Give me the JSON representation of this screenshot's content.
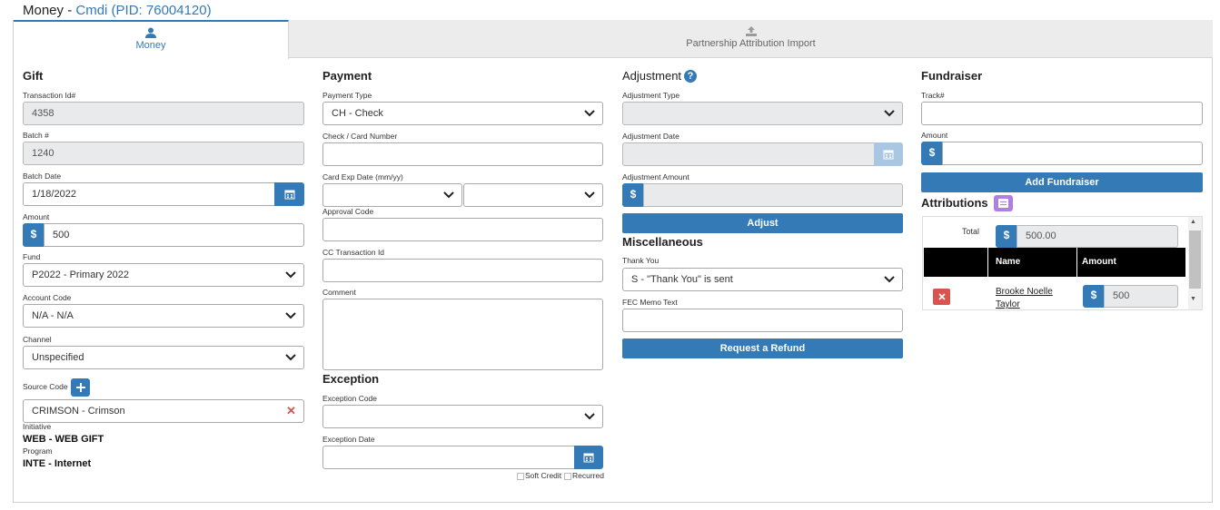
{
  "header": {
    "title": "Money",
    "sep": " - ",
    "person": "Cmdi (PID: 76004120)"
  },
  "tabs": [
    {
      "label": "Money",
      "icon": "user-icon"
    },
    {
      "label": "Partnership Attribution Import",
      "icon": "upload-icon"
    }
  ],
  "gift": {
    "heading": "Gift",
    "transaction_id_label": "Transaction Id#",
    "transaction_id": "4358",
    "batch_label": "Batch #",
    "batch": "1240",
    "batch_date_label": "Batch Date",
    "batch_date": "1/18/2022",
    "amount_label": "Amount",
    "amount": "500",
    "currency": "$",
    "fund_label": "Fund",
    "fund": "P2022 - Primary 2022",
    "account_code_label": "Account Code",
    "account_code": "N/A - N/A",
    "channel_label": "Channel",
    "channel": "Unspecified",
    "source_code_label": "Source Code",
    "source_code": "CRIMSON - Crimson",
    "initiative_label": "Initiative",
    "initiative": "WEB - WEB GIFT",
    "program_label": "Program",
    "program": "INTE - Internet"
  },
  "payment": {
    "heading": "Payment",
    "payment_type_label": "Payment Type",
    "payment_type": "CH - Check",
    "card_number_label": "Check / Card Number",
    "card_number": "",
    "card_exp_label": "Card Exp Date (mm/yy)",
    "card_exp_month": "",
    "card_exp_year": "",
    "approval_code_label": "Approval Code",
    "approval_code": "",
    "cc_transaction_label": "CC Transaction Id",
    "cc_transaction": "",
    "comment_label": "Comment",
    "comment": ""
  },
  "exception": {
    "heading": "Exception",
    "code_label": "Exception Code",
    "code": "",
    "date_label": "Exception Date",
    "date": "",
    "soft_credit_label": "Soft Credit",
    "recurred_label": "Recurred"
  },
  "adjustment": {
    "heading": "Adjustment",
    "type_label": "Adjustment Type",
    "type": "",
    "date_label": "Adjustment Date",
    "date": "",
    "amount_label": "Adjustment Amount",
    "amount": "",
    "currency": "$",
    "adjust_button": "Adjust"
  },
  "misc": {
    "heading": "Miscellaneous",
    "thank_you_label": "Thank You",
    "thank_you": "S - \"Thank You\" is sent",
    "fec_memo_label": "FEC Memo Text",
    "fec_memo": "",
    "refund_button": "Request a Refund"
  },
  "fundraiser": {
    "heading": "Fundraiser",
    "track_label": "Track#",
    "track": "",
    "amount_label": "Amount",
    "amount": "",
    "currency": "$",
    "add_button": "Add Fundraiser"
  },
  "attributions": {
    "heading": "Attributions",
    "total_label": "Total",
    "total": "500.00",
    "currency": "$",
    "columns": [
      "",
      "Name",
      "Amount"
    ],
    "rows": [
      {
        "name": "Brooke Noelle Taylor",
        "amount": "500",
        "currency": "$"
      }
    ]
  },
  "colors": {
    "primary": "#337ab7",
    "danger": "#d9534f",
    "readonly": "#e9eaec",
    "header_bg": "#000000",
    "accent_purple": "#b07fe0"
  }
}
